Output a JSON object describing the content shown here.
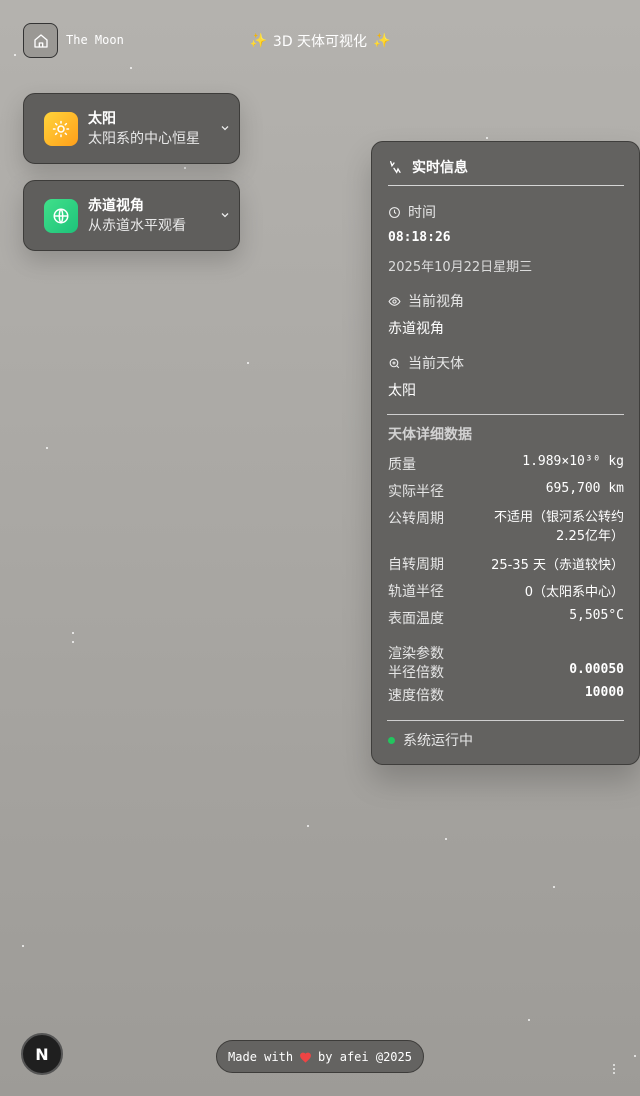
{
  "header": {
    "home_icon": "home-icon",
    "brand": "The Moon",
    "title": "3D 天体可视化"
  },
  "selectors": [
    {
      "icon": "sun-icon",
      "title": "太阳",
      "subtitle": "太阳系的中心恒星"
    },
    {
      "icon": "globe-icon",
      "title": "赤道视角",
      "subtitle": "从赤道水平观看"
    }
  ],
  "panel": {
    "title": "实时信息",
    "time_label": "时间",
    "time_value": "08:18:26",
    "date_value": "2025年10月22日星期三",
    "view_label": "当前视角",
    "view_value": "赤道视角",
    "body_label": "当前天体",
    "body_value": "太阳",
    "details_title": "天体详细数据",
    "details": [
      {
        "key": "质量",
        "value": "1.989×10³⁰ kg"
      },
      {
        "key": "实际半径",
        "value": "695,700 km"
      },
      {
        "key": "公转周期",
        "value": "不适用（银河系公转约 2.25亿年）"
      },
      {
        "key": "自转周期",
        "value": "25-35 天（赤道较快）"
      },
      {
        "key": "轨道半径",
        "value": "0（太阳系中心）"
      },
      {
        "key": "表面温度",
        "value": "5,505°C"
      }
    ],
    "render_title": "渲染参数",
    "render": [
      {
        "key": "半径倍数",
        "value": "0.00050"
      },
      {
        "key": "速度倍数",
        "value": "10000"
      }
    ],
    "status": "系统运行中",
    "status_color": "#22c55e"
  },
  "footer": {
    "badge": "N",
    "made_with": "Made with",
    "by": "by afei @2025",
    "heart_color": "#ef4444"
  }
}
